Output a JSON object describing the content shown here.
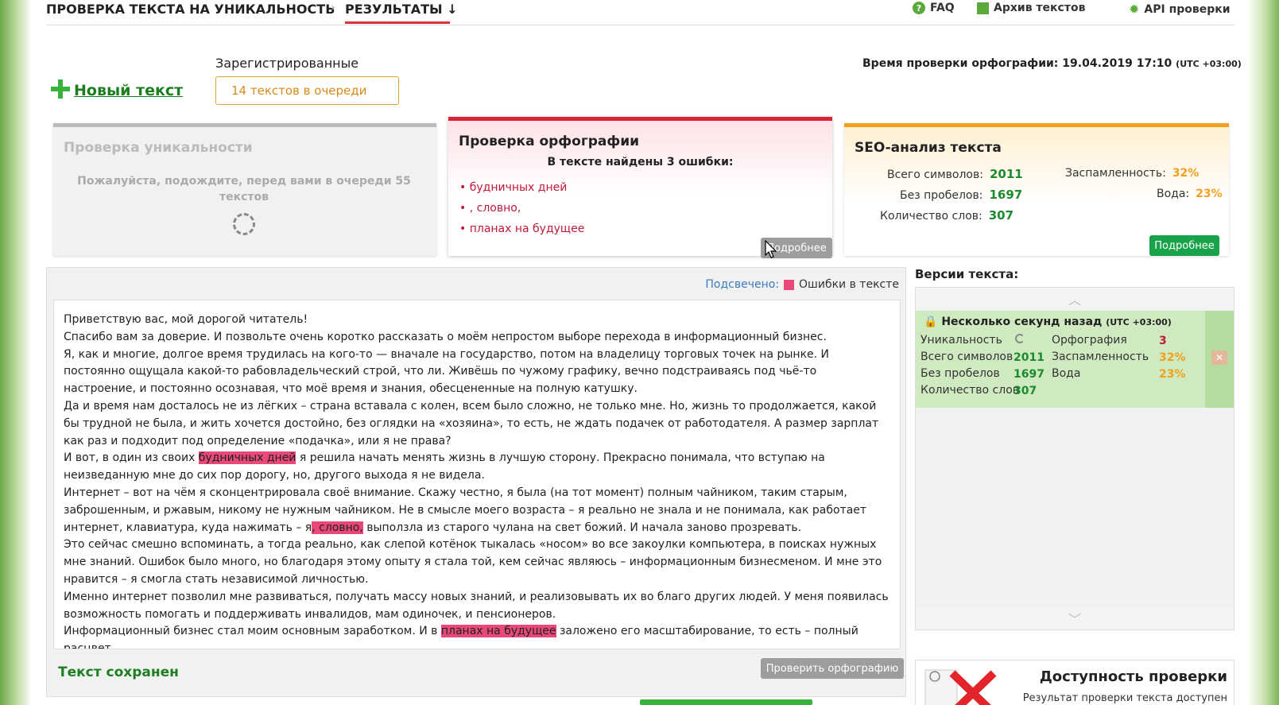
{
  "nav": {
    "crumb1": "ПРОВЕРКА ТЕКСТА НА УНИКАЛЬНОСТЬ",
    "crumb2": "РЕЗУЛЬТАТЫ ↓",
    "faq": "FAQ",
    "archive": "Архив текстов",
    "api": "API проверки"
  },
  "header": {
    "new_text": "Новый текст",
    "registered_label": "Зарегистрированные",
    "queue": "14 текстов в очереди",
    "check_time_label": "Время проверки орфографии: 19.04.2019 17:10",
    "check_time_tz": "(UTC +03:00)"
  },
  "cards": {
    "uniq": {
      "title": "Проверка уникальности",
      "wait": "Пожалуйста, подождите, перед вами в очереди 55 текстов"
    },
    "spell": {
      "title": "Проверка орфографии",
      "found": "В тексте найдены 3 ошибки:",
      "errors": [
        "будничных дней",
        ", словно,",
        "планах на будущее"
      ],
      "more": "Подробнее"
    },
    "seo": {
      "title": "SEO-анализ текста",
      "total_label": "Всего символов:",
      "total": "2011",
      "nospace_label": "Без пробелов:",
      "nospace": "1697",
      "words_label": "Количество слов:",
      "words": "307",
      "spam_label": "Заспамленность:",
      "spam": "32%",
      "water_label": "Вода:",
      "water": "23%",
      "more": "Подробнее"
    }
  },
  "editor": {
    "legend_label": "Подсвечено:",
    "legend_text": "Ошибки в тексте",
    "p1": "Приветствую вас, мой дорогой читатель!",
    "p2": "Спасибо вам за доверие. И позвольте очень коротко рассказать о моём непростом выборе перехода в информационный бизнес.",
    "p3": "Я, как и многие, долгое время трудилась на кого-то — вначале на государство, потом на владелицу торговых точек на рынке. И постоянно ощущала какой-то рабовладельческий строй, что ли. Живёшь по чужому графику, вечно подстраиваясь под чьё-то настроение, и постоянно осознавая, что моё время и знания, обесцененные на полную катушку.",
    "p4": "Да и время нам досталось не из лёгких – страна вставала с колен, всем было сложно, не только мне. Но, жизнь то продолжается, какой бы трудной не была, и жить хочется достойно, без оглядки на «хозяина», то есть, не ждать подачек от работодателя. А размер зарплат как раз и подходит под определение «подачка», или я не права?",
    "p5a": "И вот, в один из своих ",
    "p5hl": "будничных дней",
    "p5b": " я решила начать менять жизнь в лучшую сторону. Прекрасно понимала, что вступаю на неизведанную мне до сих пор дорогу, но, другого выхода я не видела.",
    "p6a": "Интернет – вот на чём я сконцентрировала своё внимание. Скажу честно, я была (на тот момент) полным чайником, таким старым, заброшенным, и ржавым, никому не нужным чайником. Не в смысле моего возраста – я реально не знала и не понимала, как работает интернет, клавиатура, куда нажимать – я",
    "p6hl": ", словно,",
    "p6b": " выползла из старого чулана на свет божий. И начала заново прозревать.",
    "p7": "Это сейчас смешно вспоминать, а тогда реально, как слепой котёнок тыкалась «носом» во все закоулки компьютера, в поисках нужных мне знаний. Ошибок было много, но благодаря этому опыту я стала той, кем сейчас являюсь – информационным бизнесменом. И мне это нравится – я смогла стать независимой личностью.",
    "p8": "Именно интернет позволил мне развиваться, получать массу новых знаний, и реализовывать их во благо других людей. У меня появилась возможность помогать и поддерживать инвалидов, мам одиночек, и пенсионеров.",
    "p9a": "Информационный бизнес стал моим основным заработком. И в ",
    "p9hl": "планах на будущее",
    "p9b": " заложено его масштабирование, то есть – полный расцвет.",
    "saved": "Текст сохранен",
    "check_button": "Проверить орфографию"
  },
  "versions": {
    "title": "Версии текста:",
    "item": {
      "time": "Несколько секунд назад",
      "tz": "(UTC +03:00)",
      "uniq_label": "Уникальность",
      "total_label": "Всего символов",
      "total": "2011",
      "nospace_label": "Без пробелов",
      "nospace": "1697",
      "words_label": "Количество слов",
      "words": "307",
      "spell_label": "Орфография",
      "spell": "3",
      "spam_label": "Заспамленность",
      "spam": "32%",
      "water_label": "Вода",
      "water": "23%"
    }
  },
  "availability": {
    "title": "Доступность проверки",
    "subtitle": "Результат проверки текста доступен"
  },
  "colors": {
    "accent_green": "#1c8a2e",
    "error_red": "#c0193a",
    "highlight_pink": "#e8497a",
    "seo_orange": "#f2a01e"
  }
}
